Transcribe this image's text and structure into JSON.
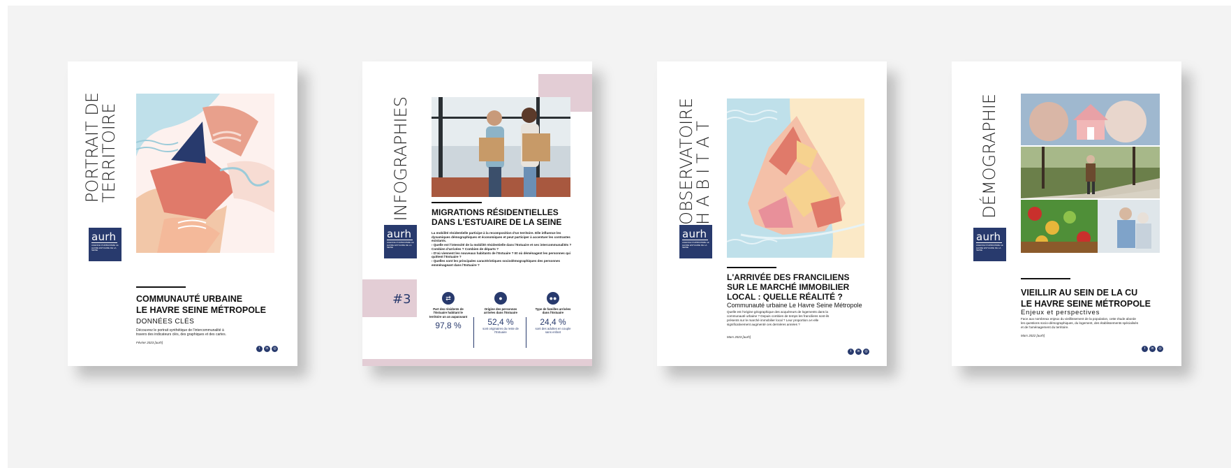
{
  "covers": [
    {
      "vertical_title": [
        "PORTRAIT DE",
        "TERRITOIRE"
      ],
      "logo": {
        "word": "aurh",
        "subtitle": "AGENCE D'URBANISME LE HAVRE ESTUAIRE DE LA SEINE"
      },
      "title": [
        "COMMUNAUTÉ URBAINE",
        "LE HAVRE SEINE MÉTROPOLE"
      ],
      "subtitle": "DONNÉES CLÉS",
      "text": "Découvrez le portrait synthétique de l'intercommunalité à travers des indicateurs clés, des graphiques et des cartes.",
      "date": "Février 2023 [aurh]"
    },
    {
      "vertical_title": [
        "INFOGRAPHIES"
      ],
      "logo": {
        "word": "aurh",
        "subtitle": "AGENCE D'URBANISME LE HAVRE ESTUAIRE DE LA SEINE"
      },
      "issue": "#3",
      "title": [
        "MIGRATIONS RÉSIDENTIELLES",
        "DANS L'ESTUAIRE DE LA SEINE"
      ],
      "intro": "La mobilité résidentielle participe à la recomposition d'un territoire. Elle influence les dynamiques démographiques et économiques et peut participer à accentuer les contrastes existants.",
      "bullets": [
        "Quelle est l'intensité de la mobilité résidentielle dans l'Estuaire et ses intercommunalités ? Combien d'arrivées ? Combien de départs ?",
        "D'où viennent les nouveaux habitants de l'Estuaire ? Et où déménagent les personnes qui quittent l'Estuaire ?",
        "Quelles sont les principales caractéristiques sociodémographiques des personnes emménageant dans l'Estuaire ?"
      ],
      "stats": [
        {
          "icon": "swap-icon",
          "label": "Part des résidents de l'Estuaire habitant le territoire un an auparavant",
          "value": "97,8 %",
          "caption": ""
        },
        {
          "icon": "person-icon",
          "label": "Origine des personnes arrivées dans l'Estuaire",
          "value": "52,4 %",
          "caption": "sont originaires du reste de l'Estuaire"
        },
        {
          "icon": "family-icon",
          "label": "Type de familles arrivées dans l'Estuaire",
          "value": "24,4 %",
          "caption": "sont des adultes en couple sans enfant"
        }
      ]
    },
    {
      "vertical_title": [
        "OBSERVATOIRE",
        "H A B I T A T"
      ],
      "logo": {
        "word": "aurh",
        "subtitle": "AGENCE D'URBANISME LE HAVRE ESTUAIRE DE LA SEINE"
      },
      "title": [
        "L'ARRIVÉE DES FRANCILIENS",
        "SUR LE MARCHÉ IMMOBILIER",
        "LOCAL : QUELLE RÉALITÉ ?"
      ],
      "subtitle": "Communauté urbaine Le Havre Seine Métropole",
      "text": "Quelle est l'origine géographique des acquéreurs de logements dans la communauté urbaine ? Depuis combien de temps les franciliens sont-ils présents sur le marché immobilier local ? Leur proportion a-t-elle significativement augmenté ces dernières années ?",
      "date": "Mars 2023 [aurh]"
    },
    {
      "vertical_title": [
        "DÉMOGRAPHIE"
      ],
      "logo": {
        "word": "aurh",
        "subtitle": "AGENCE D'URBANISME LE HAVRE ESTUAIRE DE LA SEINE"
      },
      "title": [
        "VIEILLIR AU SEIN DE LA CU",
        "LE HAVRE SEINE MÉTROPOLE"
      ],
      "subtitle": "Enjeux et perspectives",
      "text": "Face aux nombreux enjeux du vieillissement de la population, cette étude aborde les questions socio-démographiques, du logement, des établissements spécialisés et de l'aménagement du territoire.",
      "date": "Mars 2022 [aurh]"
    }
  ],
  "social_icons": [
    "twitter-icon",
    "linkedin-icon",
    "instagram-icon"
  ],
  "colors": {
    "navy": "#283a6d",
    "pink": "#e3cdd5",
    "peach": "#f2c7a8",
    "coral": "#e07a6a",
    "lightblue": "#bfe0ea"
  }
}
